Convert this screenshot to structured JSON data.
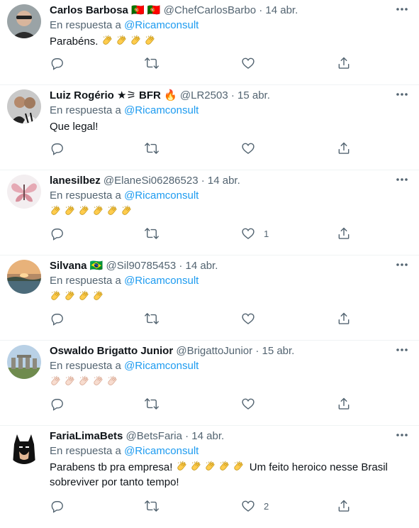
{
  "tweets": [
    {
      "name": "Carlos Barbosa",
      "badges": "🇵🇹 🇵🇹",
      "handle": "@ChefCarlosBarbo",
      "date": "· 14 abr.",
      "reply_prefix": "En respuesta a",
      "reply_mention": "@Ricamconsult",
      "text": "Parabéns.",
      "claps": 4,
      "clap_style": "yellow",
      "like_count": ""
    },
    {
      "name": "Luiz Rogério ★⚞ BFR 🔥",
      "handle": "@LR2503",
      "date": "· 15 abr.",
      "reply_prefix": "En respuesta a",
      "reply_mention": "@Ricamconsult",
      "text": "Que legal!",
      "claps": 0,
      "like_count": ""
    },
    {
      "name": "lanesilbez",
      "handle": "@ElaneSi06286523",
      "date": "· 14 abr.",
      "reply_prefix": "En respuesta a",
      "reply_mention": "@Ricamconsult",
      "text": "",
      "claps": 6,
      "clap_style": "yellow",
      "like_count": "1"
    },
    {
      "name": "Silvana 🇧🇷",
      "handle": "@Sil90785453",
      "date": "· 14 abr.",
      "reply_prefix": "En respuesta a",
      "reply_mention": "@Ricamconsult",
      "text": "",
      "claps": 4,
      "clap_style": "yellow",
      "like_count": ""
    },
    {
      "name": "Oswaldo Brigatto Junior",
      "handle": "@BrigattoJunior",
      "date": "· 15 abr.",
      "reply_prefix": "En respuesta a",
      "reply_mention": "@Ricamconsult",
      "text": "",
      "claps": 5,
      "clap_style": "light",
      "like_count": ""
    },
    {
      "name": "FariaLimaBets",
      "handle": "@BetsFaria",
      "date": "· 14 abr.",
      "reply_prefix": "En respuesta a",
      "reply_mention": "@Ricamconsult",
      "text": "Parabens tb pra empresa!",
      "claps": 5,
      "clap_style": "yellow",
      "text_after": "Um feito heroico nesse Brasil",
      "text_line2": "sobreviver por tanto tempo!",
      "like_count": "2"
    }
  ],
  "icons": {
    "reply": "reply-icon",
    "retweet": "retweet-icon",
    "like": "like-icon",
    "share": "share-icon",
    "more": "more-icon"
  },
  "colors": {
    "text": "#0f1419",
    "muted": "#536471",
    "link": "#1d9bf0",
    "divider": "#eff3f4"
  }
}
